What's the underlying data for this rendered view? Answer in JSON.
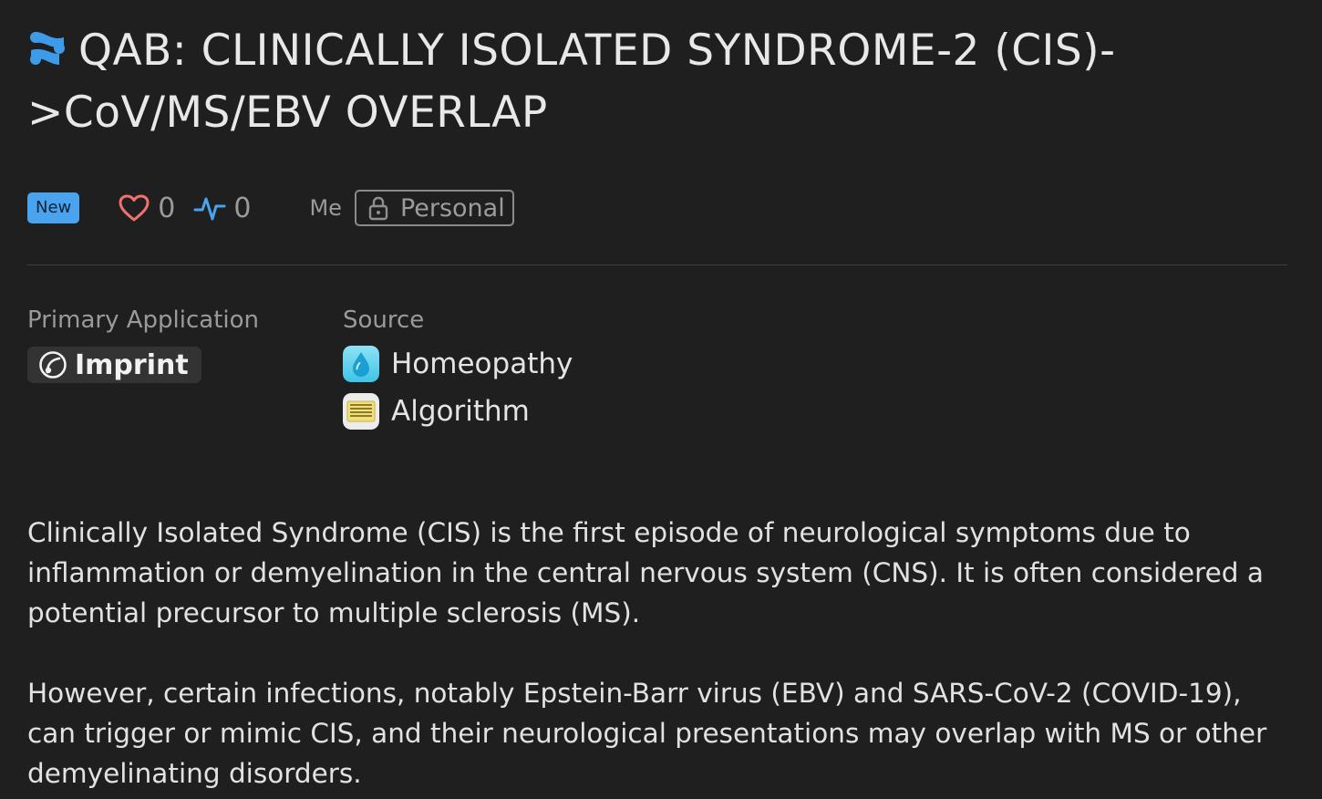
{
  "header": {
    "icon": "app-logo-icon",
    "title": "QAB: CLINICALLY ISOLATED SYNDROME-2 (CIS)->CoV/MS/EBV OVERLAP"
  },
  "meta": {
    "badge": "New",
    "likes": "0",
    "activity": "0",
    "owner": "Me",
    "privacy": "Personal",
    "colors": {
      "badge": "#4aa3ef",
      "heart": "#f0716f",
      "activity": "#4aa3ef"
    }
  },
  "primary_application": {
    "label": "Primary Application",
    "value": "Imprint",
    "icon": "imprint-icon"
  },
  "source": {
    "label": "Source",
    "items": [
      {
        "label": "Homeopathy",
        "icon": "water-drop-icon"
      },
      {
        "label": "Algorithm",
        "icon": "binary-code-icon"
      }
    ]
  },
  "description": {
    "paragraphs": [
      "Clinically Isolated Syndrome (CIS) is the first episode of neurological symptoms due to inflammation or demyelination in the central nervous system (CNS). It is often considered a potential precursor to multiple sclerosis (MS).",
      "However, certain infections, notably Epstein-Barr virus (EBV) and SARS-CoV-2 (COVID-19), can trigger or mimic CIS, and their neurological presentations may overlap with MS or other demyelinating disorders."
    ]
  }
}
